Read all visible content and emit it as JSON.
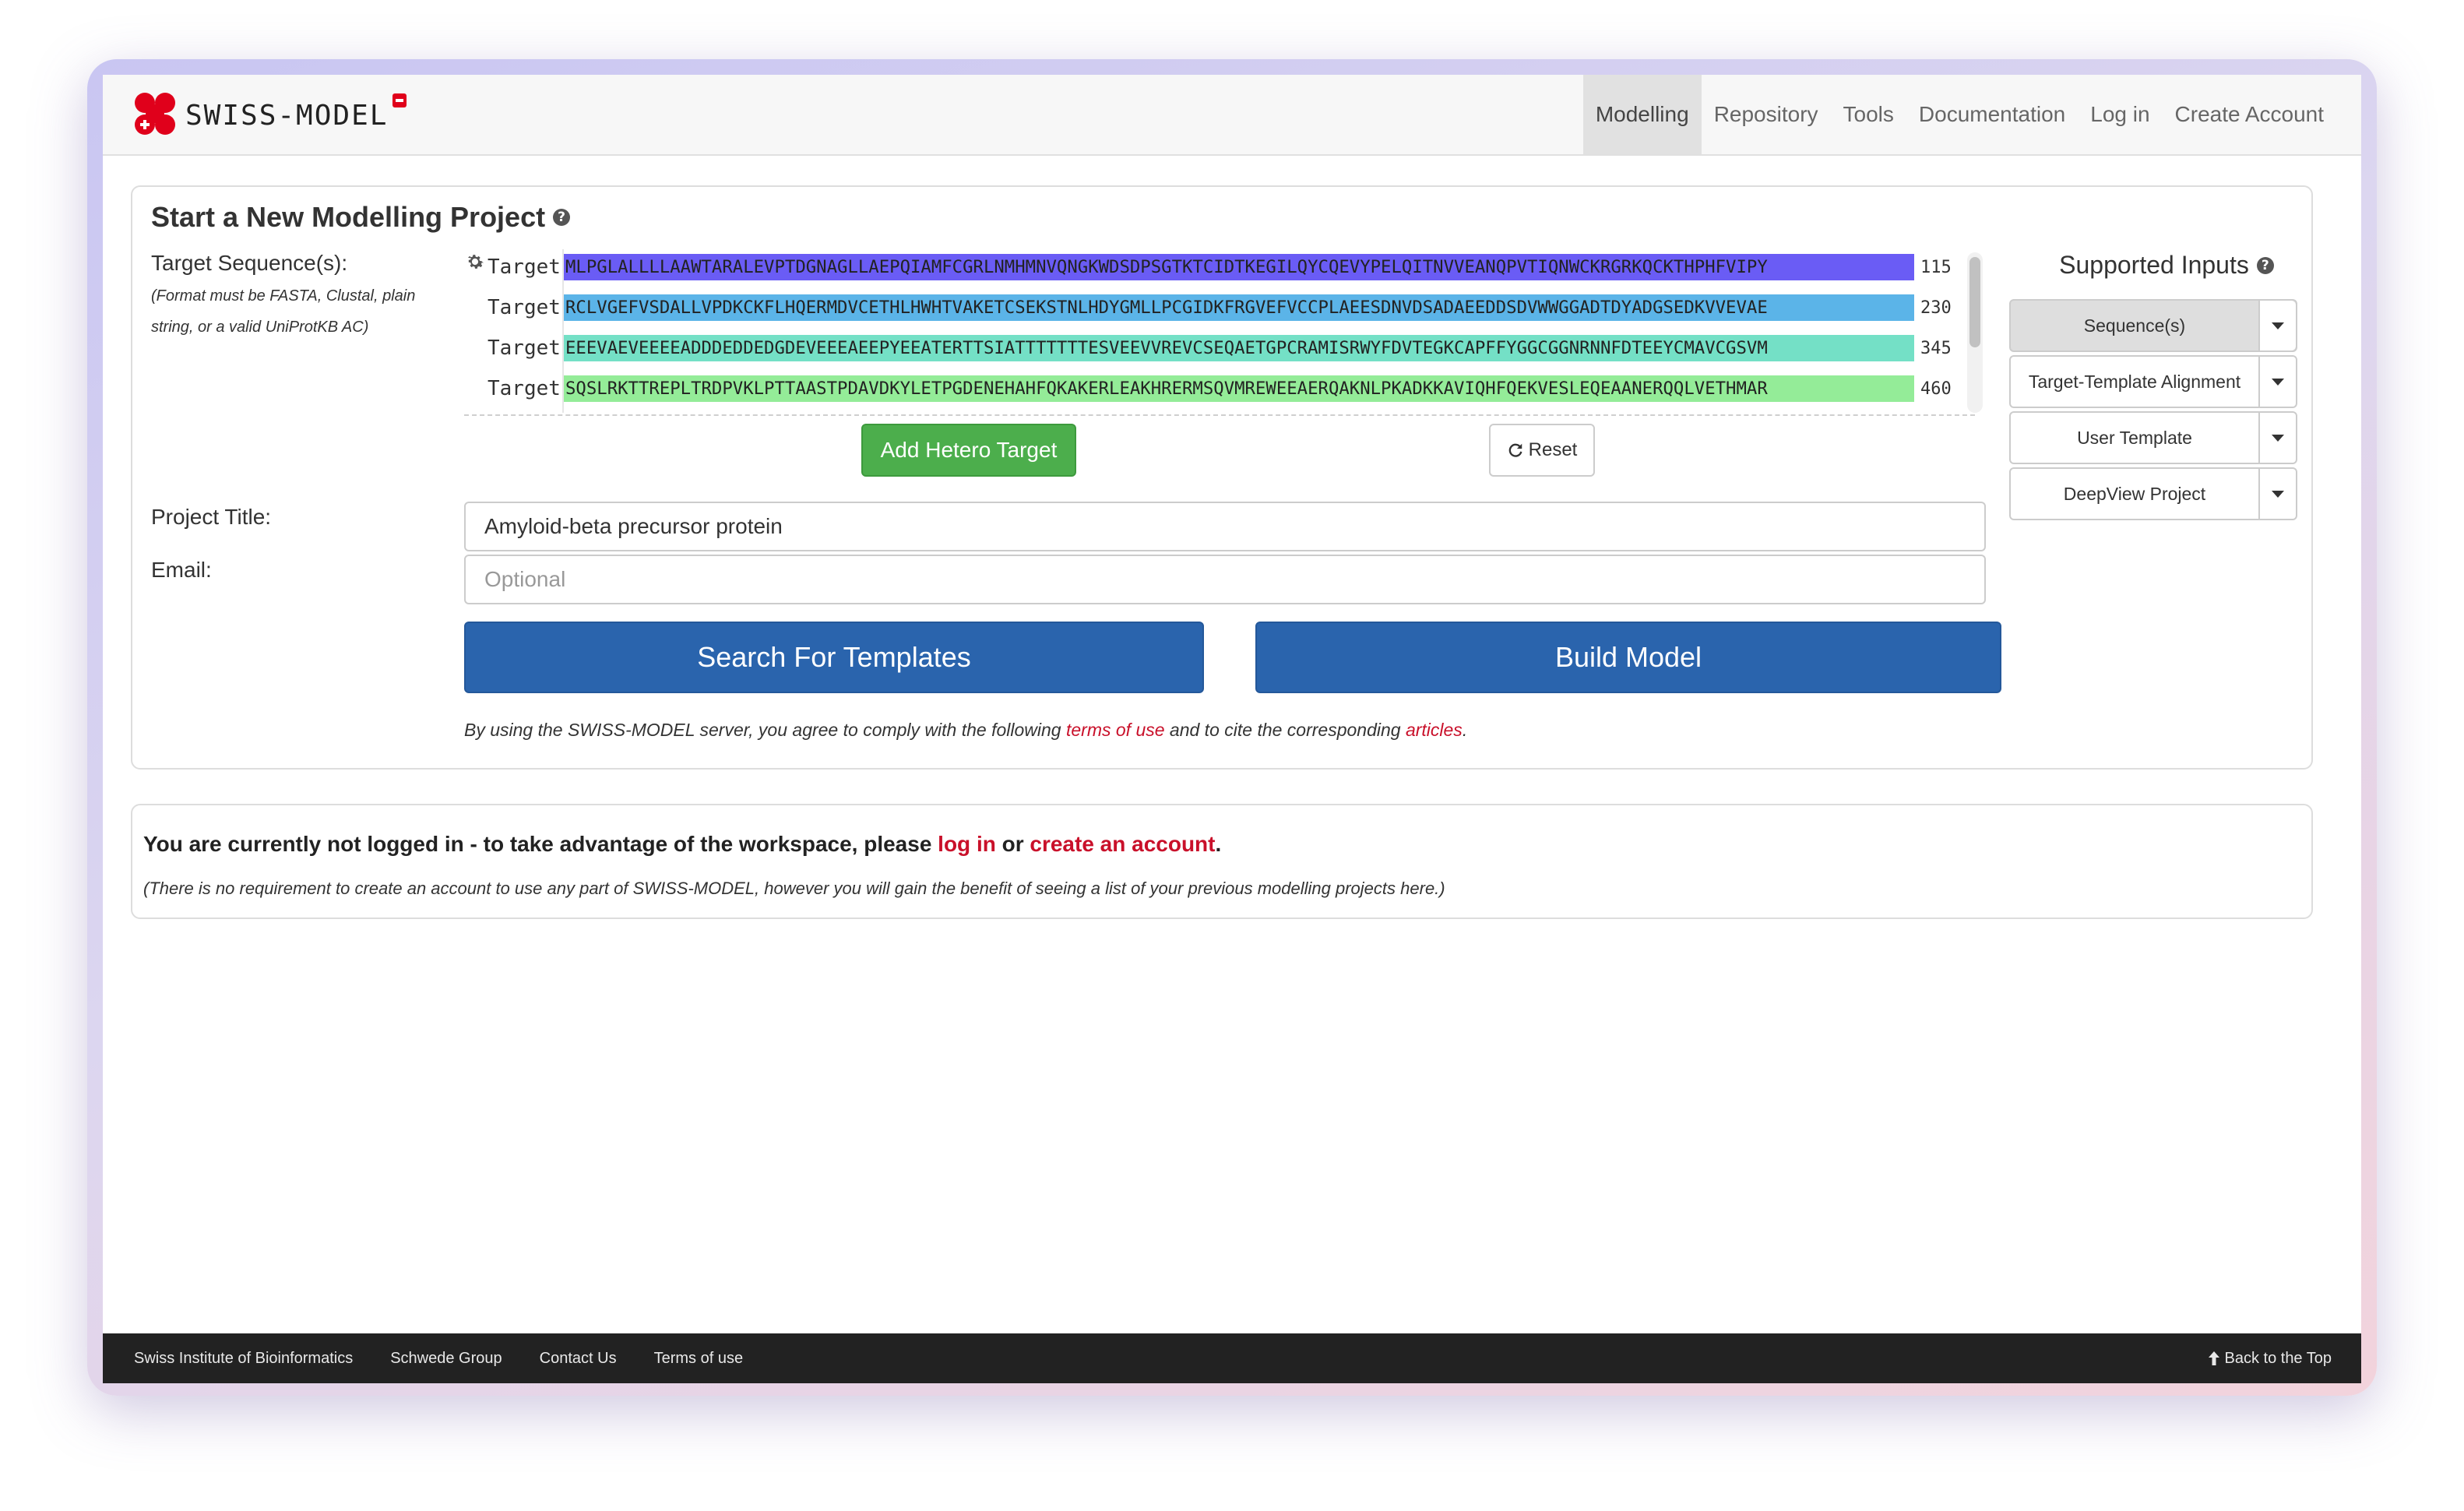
{
  "brand": {
    "name": "SWISS-MODEL"
  },
  "nav": {
    "items": [
      {
        "label": "Modelling",
        "active": true
      },
      {
        "label": "Repository"
      },
      {
        "label": "Tools"
      },
      {
        "label": "Documentation"
      },
      {
        "label": "Log in"
      },
      {
        "label": "Create Account"
      }
    ]
  },
  "project": {
    "heading": "Start a New Modelling Project",
    "target_label": "Target Sequence(s):",
    "format_hint": "(Format must be FASTA, Clustal, plain string, or a valid UniProtKB AC)",
    "sequence_rows": [
      {
        "label": "Target",
        "seq": "MLPGLALLLLAAWTARALEVPTDGNAGLLAEPQIAMFCGRLNMHMNVQNGKWDSDPSGTKTCIDTKEGILQYCQEVYPELQITNVVEANQPVTIQNWCKRGRKQCKTHPHFVIPY",
        "end": "115",
        "color": "#6a5cf5"
      },
      {
        "label": "Target",
        "seq": "RCLVGEFVSDALLVPDKCKFLHQERMDVCETHLHWHTVAKETCSEKSTNLHDYGMLLPCGIDKFRGVEFVCCPLAEESDNVDSADAEEDDSDVWWGGADTDYADGSEDKVVEVAE",
        "end": "230",
        "color": "#5bb4e8"
      },
      {
        "label": "Target",
        "seq": "EEEVAEVEEEEADDDEDDEDGDEVEEEAEEPYEEATERTTSIATTTTTTTESVEEVVREVCSEQAETGPCRAMISRWYFDVTEGKCAPFFYGGCGGNRNNFDTEEYCMAVCGSVM",
        "end": "345",
        "color": "#74e0c6"
      },
      {
        "label": "Target",
        "seq": "SQSLRKTTREPLTRDPVKLPTTAASTPDAVDKYLETPGDENEHAHFQKAKERLEAKHRERMSQVMREWEEAERQAKNLPKADKKAVIQHFQEKVESLEQEAANERQQLVETHMAR",
        "end": "460",
        "color": "#94ec98"
      }
    ],
    "add_hetero_label": "Add Hetero Target",
    "reset_label": "Reset",
    "title_label": "Project Title:",
    "title_value": "Amyloid-beta precursor protein",
    "email_label": "Email:",
    "email_placeholder": "Optional",
    "search_label": "Search For Templates",
    "build_label": "Build Model",
    "terms": {
      "pre": "By using the SWISS-MODEL server, you agree to comply with the following ",
      "link1": "terms of use",
      "mid": " and to cite the corresponding ",
      "link2": "articles",
      "post": "."
    }
  },
  "supported": {
    "title": "Supported Inputs",
    "options": [
      {
        "label": "Sequence(s)",
        "active": true
      },
      {
        "label": "Target-Template Alignment"
      },
      {
        "label": "User Template"
      },
      {
        "label": "DeepView Project"
      }
    ]
  },
  "login": {
    "pre": "You are currently not logged in - to take advantage of the workspace, please ",
    "link1": "log in",
    "mid": " or ",
    "link2": "create an account",
    "post": ".",
    "note": "(There is no requirement to create an account to use any part of SWISS-MODEL, however you will gain the benefit of seeing a list of your previous modelling projects here.)"
  },
  "footer": {
    "links": [
      "Swiss Institute of Bioinformatics",
      "Schwede Group",
      "Contact Us",
      "Terms of use"
    ],
    "back_to_top": "Back to the Top"
  },
  "colors": {
    "accent_blue": "#2a64ad",
    "accent_green": "#4cae4c",
    "link_red": "#c9102a"
  }
}
